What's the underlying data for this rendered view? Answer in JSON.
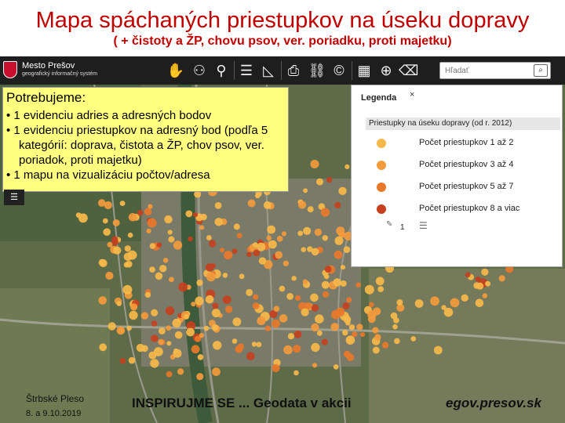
{
  "slide": {
    "title": "Mapa spáchaných priestupkov na úseku dopravy",
    "subtitle": "( + čistoty a ŽP, chovu psov, ver. poriadku, proti majetku)"
  },
  "app": {
    "logo_name": "Mesto Prešov",
    "logo_subtitle": "geografický informačný systém"
  },
  "toolbar": {
    "icons": [
      "pan-hand-icon",
      "binoculars-icon",
      "location-pin-icon",
      "list-icon",
      "measure-icon",
      "table-icon",
      "print-icon",
      "link-icon",
      "copyright-icon",
      "calendar-icon",
      "help-icon",
      "delete-icon"
    ]
  },
  "search": {
    "placeholder": "Hľadať"
  },
  "callout": {
    "heading": "Potrebujeme:",
    "items": [
      "1 evidenciu adries a adresných bodov",
      "1 evidenciu priestupkov na adresný bod (podľa 5 kategórií: doprava, čistota a ŽP, chov psov, ver. poriadok, proti majetku)",
      "1 mapu na vizualizáciu počtov/adresa"
    ]
  },
  "legend": {
    "heading": "Legenda",
    "close": "×",
    "group": "Priestupky na úseku dopravy (od r. 2012)",
    "items": [
      {
        "label": "Počet priestupkov 1 až 2",
        "color": "#f7b84a"
      },
      {
        "label": "Počet priestupkov 3 až 4",
        "color": "#f39a3c"
      },
      {
        "label": "Počet priestupkov 5 až 7",
        "color": "#e8782a"
      },
      {
        "label": "Počet priestupkov 8 a viac",
        "color": "#c4401e"
      }
    ],
    "footer_number": "1"
  },
  "footer": {
    "place": "Štrbské Pleso",
    "date": "8. a 9.10.2019",
    "center": "INSPIRUJME SE ... Geodata v akcii",
    "right": "egov.presov.sk"
  },
  "colors": {
    "title_red": "#c00000",
    "toolbar_bg": "#1e1e1e",
    "callout_bg": "#ffff80",
    "dot_light": "#f7b84a",
    "dot_mid": "#f39a3c",
    "dot_dark": "#e8782a",
    "dot_red": "#c4401e"
  }
}
